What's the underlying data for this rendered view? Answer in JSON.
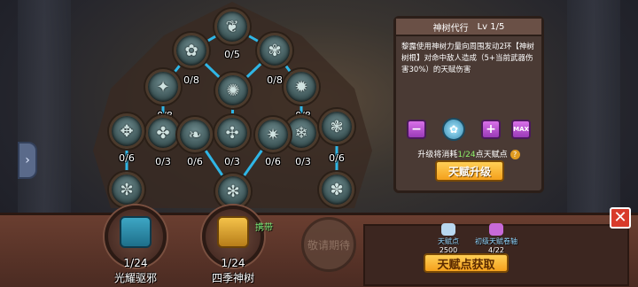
{
  "tree": {
    "nodes": [
      {
        "id": "top",
        "glyph": "❦",
        "level": "0/5"
      },
      {
        "id": "r1-l",
        "glyph": "✿",
        "level": "0/8"
      },
      {
        "id": "r1-r",
        "glyph": "✾",
        "level": "0/8"
      },
      {
        "id": "r2-l",
        "glyph": "✦",
        "level": "0/8"
      },
      {
        "id": "r2-m",
        "glyph": "✺",
        "level": ""
      },
      {
        "id": "r2-r",
        "glyph": "✹",
        "level": "0/8"
      },
      {
        "id": "r3-ll",
        "glyph": "✤",
        "level": "0/3"
      },
      {
        "id": "r3-m",
        "glyph": "✣",
        "level": "0/3"
      },
      {
        "id": "r3-rr",
        "glyph": "❄",
        "level": "0/3"
      },
      {
        "id": "r4-ll",
        "glyph": "✥",
        "level": "0/6"
      },
      {
        "id": "r4-l",
        "glyph": "❧",
        "level": "0/6"
      },
      {
        "id": "r4-r",
        "glyph": "✷",
        "level": "0/6"
      },
      {
        "id": "r4-rr",
        "glyph": "❃",
        "level": "0/6"
      },
      {
        "id": "r5-ll",
        "glyph": "✼",
        "level": ""
      },
      {
        "id": "r5-m",
        "glyph": "✻",
        "level": ""
      },
      {
        "id": "r5-rr",
        "glyph": "✽",
        "level": ""
      }
    ]
  },
  "panel": {
    "title": "神树代行",
    "level": "Lv 1/5",
    "desc_parts": [
      {
        "text": "黎露使用神树力量向周围发动2环【神树树根】对命中敌人造成（5+当前武器伤害30%）的天赋伤害",
        "cls": ""
      }
    ],
    "minus_label": "−",
    "plus_label": "+",
    "max_label": "MAX",
    "cost_prefix": "升级将消耗",
    "cost_value": "1/24",
    "cost_suffix": "点天赋点",
    "help": "?",
    "upgrade_label": "天赋升级"
  },
  "bottom": {
    "slots": [
      {
        "count": "1/24",
        "name": "光耀驱邪"
      },
      {
        "count": "1/24",
        "name": "四季神树"
      }
    ],
    "equipped_tag": "携带",
    "locked_label": "敬请期待",
    "resources": [
      {
        "label": "天赋点",
        "value": "2500",
        "color": "#b9d8f0"
      },
      {
        "label": "初级天赋卷轴",
        "value": "4/22",
        "color": "#c86ad8"
      }
    ],
    "get_points_label": "天赋点获取",
    "close_label": "✕"
  },
  "nav": {
    "left_tab": "›"
  },
  "colors": {
    "line": "#2fb6e6",
    "accent": "#f4a01c"
  }
}
